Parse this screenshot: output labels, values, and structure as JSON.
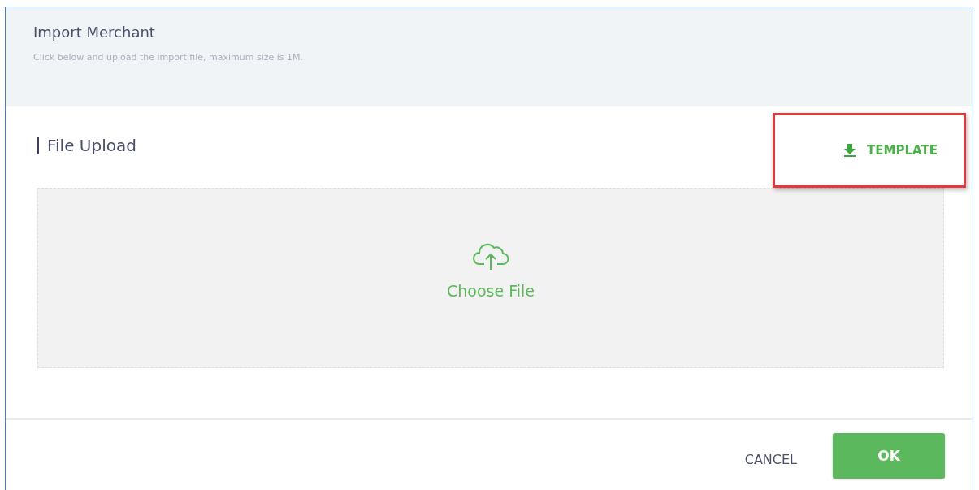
{
  "dialog": {
    "title": "Import Merchant",
    "subtitle": "Click below and upload the import file, maximum size is 1M."
  },
  "section": {
    "title": "File Upload",
    "template_link": "TEMPLATE"
  },
  "upload": {
    "label": "Choose File"
  },
  "buttons": [
    {
      "kind": "text",
      "label": "CANCEL"
    },
    {
      "kind": "primary",
      "label": "OK"
    }
  ]
}
